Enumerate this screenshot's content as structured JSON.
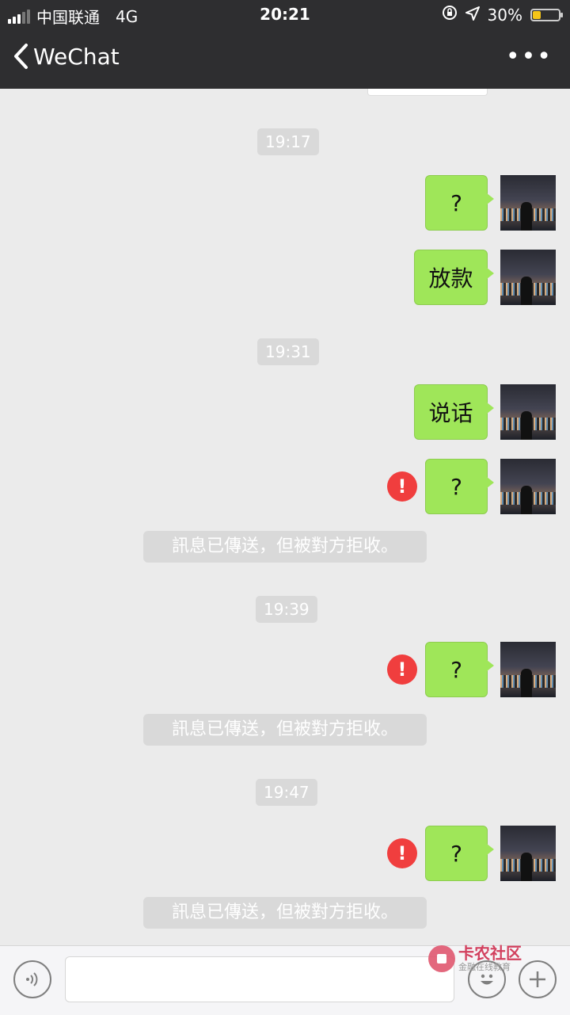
{
  "status_bar": {
    "carrier": "中国联通",
    "network": "4G",
    "time": "20:21",
    "battery": "30%",
    "battery_level": 0.3
  },
  "nav": {
    "back_label": "WeChat",
    "more_label": "•••"
  },
  "messages": [
    {
      "time": "19:17"
    },
    {
      "text": "?"
    },
    {
      "text": "放款"
    },
    {
      "time": "19:31"
    },
    {
      "text": "说话"
    },
    {
      "text": "?",
      "error": "!"
    },
    {
      "system": "訊息已傳送，但被對方拒收。"
    },
    {
      "time": "19:39"
    },
    {
      "text": "?",
      "error": "!"
    },
    {
      "system": "訊息已傳送，但被對方拒收。"
    },
    {
      "time": "19:47"
    },
    {
      "text": "?",
      "error": "!"
    },
    {
      "system": "訊息已傳送，但被對方拒收。"
    }
  ],
  "watermark": {
    "name": "卡农社区",
    "tagline": "金融在线教育"
  },
  "colors": {
    "bubble": "#9fe659",
    "nav": "#2e2e30",
    "background": "#ebebeb",
    "error": "#f03e3e"
  }
}
